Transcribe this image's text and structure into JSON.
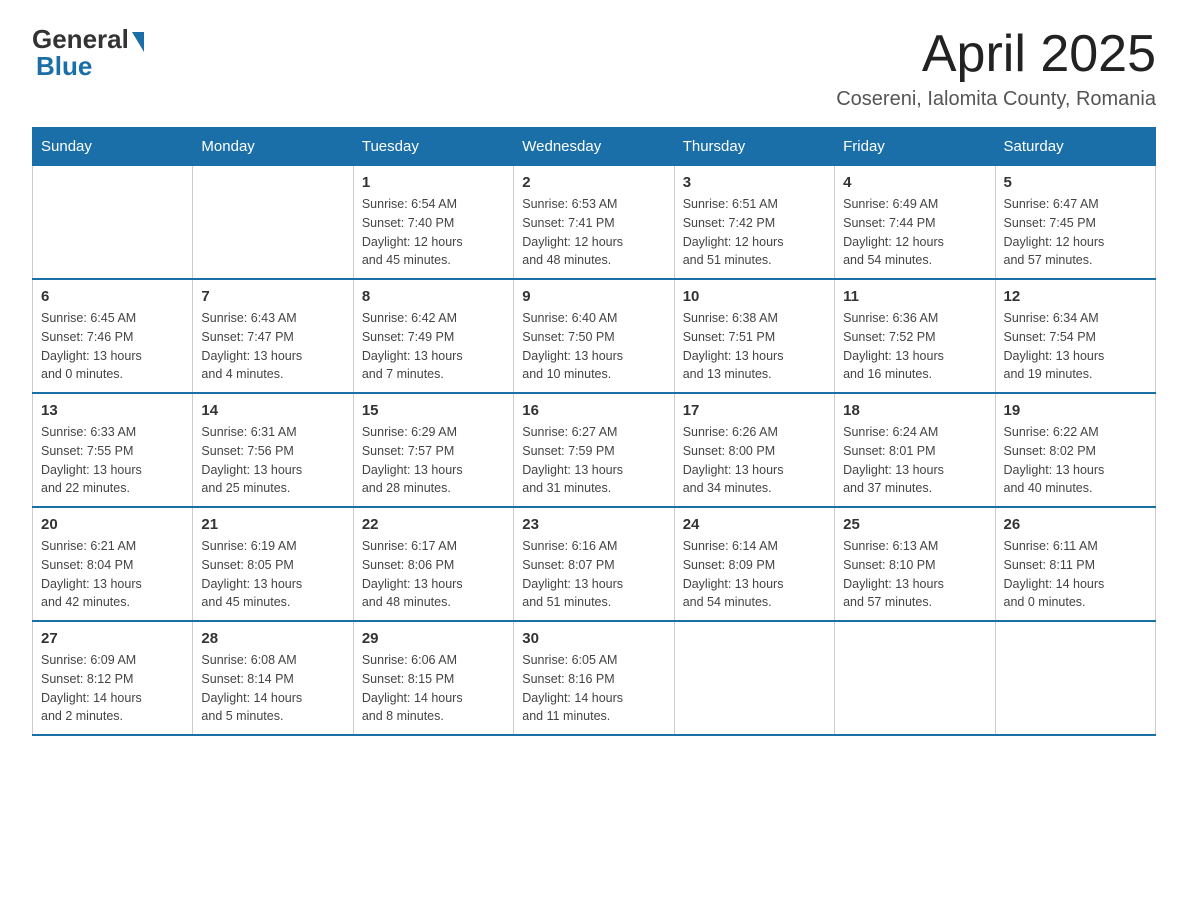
{
  "logo": {
    "general": "General",
    "blue": "Blue"
  },
  "title": "April 2025",
  "location": "Cosereni, Ialomita County, Romania",
  "days_of_week": [
    "Sunday",
    "Monday",
    "Tuesday",
    "Wednesday",
    "Thursday",
    "Friday",
    "Saturday"
  ],
  "weeks": [
    [
      {
        "day": "",
        "info": ""
      },
      {
        "day": "",
        "info": ""
      },
      {
        "day": "1",
        "info": "Sunrise: 6:54 AM\nSunset: 7:40 PM\nDaylight: 12 hours\nand 45 minutes."
      },
      {
        "day": "2",
        "info": "Sunrise: 6:53 AM\nSunset: 7:41 PM\nDaylight: 12 hours\nand 48 minutes."
      },
      {
        "day": "3",
        "info": "Sunrise: 6:51 AM\nSunset: 7:42 PM\nDaylight: 12 hours\nand 51 minutes."
      },
      {
        "day": "4",
        "info": "Sunrise: 6:49 AM\nSunset: 7:44 PM\nDaylight: 12 hours\nand 54 minutes."
      },
      {
        "day": "5",
        "info": "Sunrise: 6:47 AM\nSunset: 7:45 PM\nDaylight: 12 hours\nand 57 minutes."
      }
    ],
    [
      {
        "day": "6",
        "info": "Sunrise: 6:45 AM\nSunset: 7:46 PM\nDaylight: 13 hours\nand 0 minutes."
      },
      {
        "day": "7",
        "info": "Sunrise: 6:43 AM\nSunset: 7:47 PM\nDaylight: 13 hours\nand 4 minutes."
      },
      {
        "day": "8",
        "info": "Sunrise: 6:42 AM\nSunset: 7:49 PM\nDaylight: 13 hours\nand 7 minutes."
      },
      {
        "day": "9",
        "info": "Sunrise: 6:40 AM\nSunset: 7:50 PM\nDaylight: 13 hours\nand 10 minutes."
      },
      {
        "day": "10",
        "info": "Sunrise: 6:38 AM\nSunset: 7:51 PM\nDaylight: 13 hours\nand 13 minutes."
      },
      {
        "day": "11",
        "info": "Sunrise: 6:36 AM\nSunset: 7:52 PM\nDaylight: 13 hours\nand 16 minutes."
      },
      {
        "day": "12",
        "info": "Sunrise: 6:34 AM\nSunset: 7:54 PM\nDaylight: 13 hours\nand 19 minutes."
      }
    ],
    [
      {
        "day": "13",
        "info": "Sunrise: 6:33 AM\nSunset: 7:55 PM\nDaylight: 13 hours\nand 22 minutes."
      },
      {
        "day": "14",
        "info": "Sunrise: 6:31 AM\nSunset: 7:56 PM\nDaylight: 13 hours\nand 25 minutes."
      },
      {
        "day": "15",
        "info": "Sunrise: 6:29 AM\nSunset: 7:57 PM\nDaylight: 13 hours\nand 28 minutes."
      },
      {
        "day": "16",
        "info": "Sunrise: 6:27 AM\nSunset: 7:59 PM\nDaylight: 13 hours\nand 31 minutes."
      },
      {
        "day": "17",
        "info": "Sunrise: 6:26 AM\nSunset: 8:00 PM\nDaylight: 13 hours\nand 34 minutes."
      },
      {
        "day": "18",
        "info": "Sunrise: 6:24 AM\nSunset: 8:01 PM\nDaylight: 13 hours\nand 37 minutes."
      },
      {
        "day": "19",
        "info": "Sunrise: 6:22 AM\nSunset: 8:02 PM\nDaylight: 13 hours\nand 40 minutes."
      }
    ],
    [
      {
        "day": "20",
        "info": "Sunrise: 6:21 AM\nSunset: 8:04 PM\nDaylight: 13 hours\nand 42 minutes."
      },
      {
        "day": "21",
        "info": "Sunrise: 6:19 AM\nSunset: 8:05 PM\nDaylight: 13 hours\nand 45 minutes."
      },
      {
        "day": "22",
        "info": "Sunrise: 6:17 AM\nSunset: 8:06 PM\nDaylight: 13 hours\nand 48 minutes."
      },
      {
        "day": "23",
        "info": "Sunrise: 6:16 AM\nSunset: 8:07 PM\nDaylight: 13 hours\nand 51 minutes."
      },
      {
        "day": "24",
        "info": "Sunrise: 6:14 AM\nSunset: 8:09 PM\nDaylight: 13 hours\nand 54 minutes."
      },
      {
        "day": "25",
        "info": "Sunrise: 6:13 AM\nSunset: 8:10 PM\nDaylight: 13 hours\nand 57 minutes."
      },
      {
        "day": "26",
        "info": "Sunrise: 6:11 AM\nSunset: 8:11 PM\nDaylight: 14 hours\nand 0 minutes."
      }
    ],
    [
      {
        "day": "27",
        "info": "Sunrise: 6:09 AM\nSunset: 8:12 PM\nDaylight: 14 hours\nand 2 minutes."
      },
      {
        "day": "28",
        "info": "Sunrise: 6:08 AM\nSunset: 8:14 PM\nDaylight: 14 hours\nand 5 minutes."
      },
      {
        "day": "29",
        "info": "Sunrise: 6:06 AM\nSunset: 8:15 PM\nDaylight: 14 hours\nand 8 minutes."
      },
      {
        "day": "30",
        "info": "Sunrise: 6:05 AM\nSunset: 8:16 PM\nDaylight: 14 hours\nand 11 minutes."
      },
      {
        "day": "",
        "info": ""
      },
      {
        "day": "",
        "info": ""
      },
      {
        "day": "",
        "info": ""
      }
    ]
  ]
}
